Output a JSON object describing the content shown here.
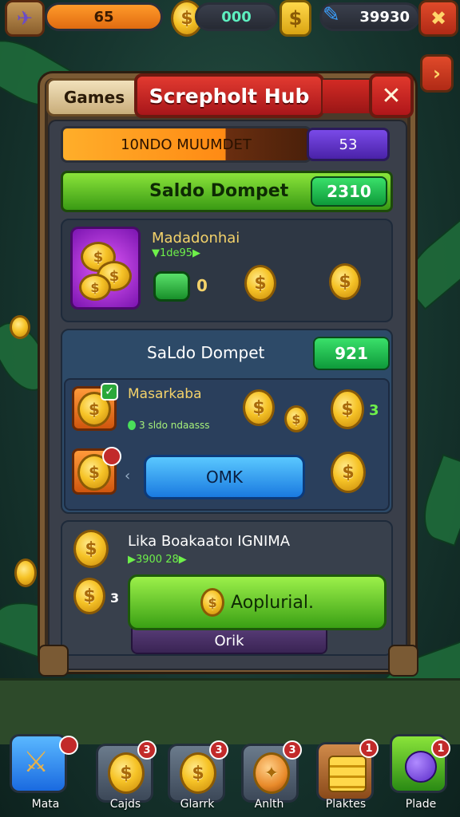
{
  "topbar": {
    "energy_value": "65",
    "coins_value": "000",
    "gems_value": "39930",
    "close_symbol": "✖"
  },
  "side_button_symbol": "›",
  "dialog": {
    "games_tab": "Games",
    "title": "Screpholt Hub",
    "close_symbol": "✕"
  },
  "progress": {
    "label": "10NDO MUUMDET",
    "value": "53"
  },
  "balance_bar": {
    "label": "Saldo Dompet",
    "value": "2310"
  },
  "card1": {
    "title": "Madadonhai",
    "subtitle": "▼1de95▶",
    "cash_value": "0",
    "coin_symbol": "$"
  },
  "card2": {
    "header": "SaLdo Dompet",
    "value": "921",
    "item1_title": "Masarkaba",
    "item1_sub": "3 sldo ndaasss",
    "item1_side": "3",
    "item2_side": "‹",
    "ok_button": "OMK"
  },
  "card3": {
    "title": "Lika Boakaatoı IGNIMA",
    "subtitle": "▶3900 28▶",
    "side": "3",
    "apply_button": "Aoplurial.",
    "ok_button": "Orik"
  },
  "bottom_tabs": [
    {
      "label": "Mata",
      "badge": ""
    },
    {
      "label": "Cajds",
      "badge": "3"
    },
    {
      "label": "Glarrk",
      "badge": "3"
    },
    {
      "label": "Anlth",
      "badge": "3"
    },
    {
      "label": "Plaktes",
      "badge": "1"
    },
    {
      "label": "Plade",
      "badge": "1"
    }
  ]
}
